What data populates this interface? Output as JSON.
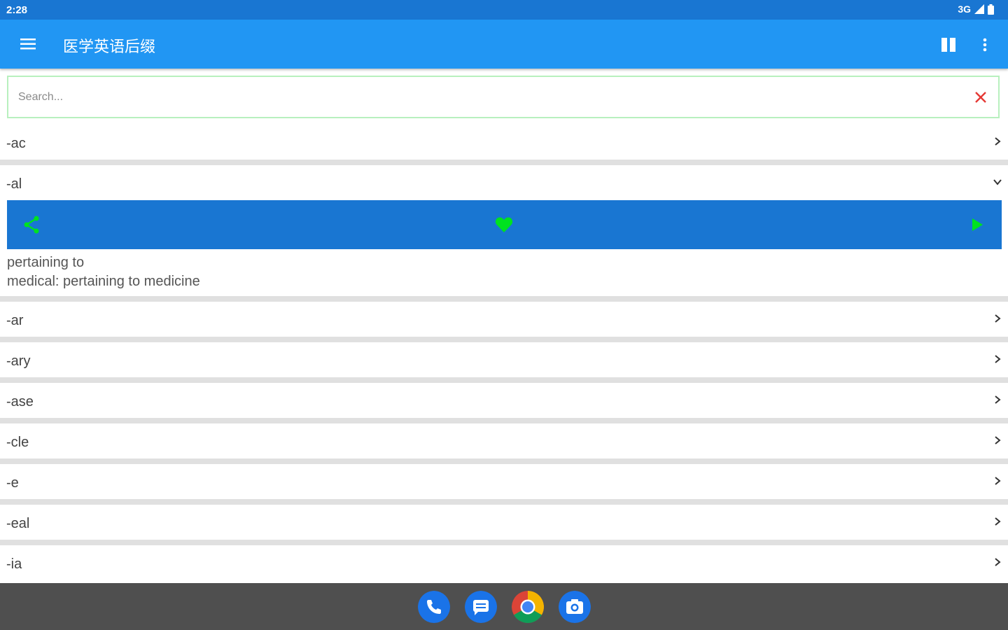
{
  "status_bar": {
    "time": "2:28",
    "network": "3G"
  },
  "app_bar": {
    "title": "医学英语后缀",
    "menu_icon": "hamburger-menu-icon",
    "pause_icon": "pause-icon",
    "more_icon": "more-vert-icon"
  },
  "search": {
    "placeholder": "Search...",
    "value": "",
    "clear_icon": "close-icon",
    "clear_color": "#e53935"
  },
  "list": {
    "items_before": [
      {
        "label": "-ac",
        "icon": "chevron-right-icon"
      }
    ],
    "expanded": {
      "label": "-al",
      "icon": "chevron-down-icon",
      "actions": {
        "share_icon": "share-icon",
        "favorite_icon": "heart-icon",
        "play_icon": "play-icon",
        "accent": "#00e21f"
      },
      "definitions": [
        "pertaining to",
        "medical: pertaining to medicine"
      ]
    },
    "items_after": [
      {
        "label": "-ar",
        "icon": "chevron-right-icon"
      },
      {
        "label": "-ary",
        "icon": "chevron-right-icon"
      },
      {
        "label": "-ase",
        "icon": "chevron-right-icon"
      },
      {
        "label": "-cle",
        "icon": "chevron-right-icon"
      },
      {
        "label": "-e",
        "icon": "chevron-right-icon"
      },
      {
        "label": "-eal",
        "icon": "chevron-right-icon"
      },
      {
        "label": "-ia",
        "icon": "chevron-right-icon"
      }
    ]
  },
  "dock": {
    "apps": [
      "phone-icon",
      "messages-icon",
      "chrome-icon",
      "camera-icon"
    ]
  },
  "colors": {
    "status_bar": "#1976d2",
    "app_bar": "#2196f3",
    "action_bar": "#1976d2",
    "search_border": "#b8f0be"
  }
}
